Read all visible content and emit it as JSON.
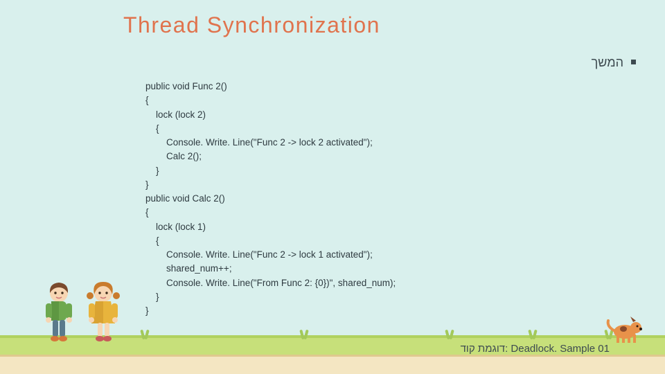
{
  "title": "Thread Synchronization",
  "subtitle": "המשך",
  "code": {
    "l01": "public void Func 2()",
    "l02": "{",
    "l03": "    lock (lock 2)",
    "l04": "    {",
    "l05": "        Console. Write. Line(\"Func 2 -> lock 2 activated\");",
    "l06": "        Calc 2();",
    "l07": "    }",
    "l08": "}",
    "l09": "public void Calc 2()",
    "l10": "{",
    "l11": "    lock (lock 1)",
    "l12": "    {",
    "l13": "        Console. Write. Line(\"Func 2 -> lock 1 activated\");",
    "l14": "        shared_num++;",
    "l15": "        Console. Write. Line(\"From Func 2: {0})\", shared_num);",
    "l16": "    }",
    "l17": "}"
  },
  "footer_heb": "דוגמת קוד:",
  "footer_eng": "Deadlock. Sample 01"
}
